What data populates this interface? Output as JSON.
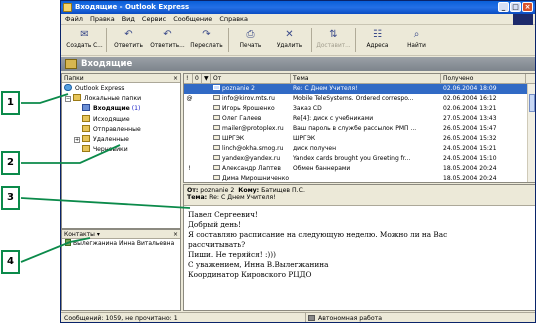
{
  "window": {
    "title": "Входящие - Outlook Express",
    "controls": [
      "_",
      "□",
      "×"
    ]
  },
  "menu": [
    "Файл",
    "Правка",
    "Вид",
    "Сервис",
    "Сообщение",
    "Справка"
  ],
  "toolbar": [
    {
      "label": "Создать С...",
      "icon": "new-mail-icon",
      "enabled": true
    },
    {
      "label": "Ответить",
      "icon": "reply-icon",
      "enabled": true
    },
    {
      "label": "Ответить...",
      "icon": "reply-all-icon",
      "enabled": true
    },
    {
      "label": "Переслать",
      "icon": "forward-icon",
      "enabled": true
    },
    {
      "label": "Печать",
      "icon": "print-icon",
      "enabled": true
    },
    {
      "label": "Удалить",
      "icon": "delete-icon",
      "enabled": true
    },
    {
      "label": "Доставит...",
      "icon": "send-receive-icon",
      "enabled": false
    },
    {
      "label": "Адреса",
      "icon": "address-book-icon",
      "enabled": true
    },
    {
      "label": "Найти",
      "icon": "find-icon",
      "enabled": true
    }
  ],
  "folder_title": "Входящие",
  "folders_pane": {
    "title": "Папки",
    "close": "×",
    "items": [
      {
        "label": "Outlook Express",
        "count": "",
        "level": 0,
        "type": "root"
      },
      {
        "label": "Локальные папки",
        "count": "",
        "level": 1,
        "type": "folder",
        "expander": "−"
      },
      {
        "label": "Входящие",
        "count": "(1)",
        "level": 2,
        "type": "inbox",
        "selected": true
      },
      {
        "label": "Исходящие",
        "count": "",
        "level": 2,
        "type": "folder"
      },
      {
        "label": "Отправленные",
        "count": "",
        "level": 2,
        "type": "folder"
      },
      {
        "label": "Удаленные",
        "count": "",
        "level": 2,
        "type": "folder",
        "expander": "+"
      },
      {
        "label": "Черновики",
        "count": "",
        "level": 2,
        "type": "folder"
      }
    ]
  },
  "contacts_pane": {
    "title": "Контакты",
    "close": "×",
    "items": [
      "Вылегжанина Инна Витальевна"
    ]
  },
  "message_list": {
    "columns": [
      "!",
      "0",
      "▼",
      "От",
      "Тема",
      "Получено"
    ],
    "messages": [
      {
        "from": "poznanie 2",
        "subject": "Re: С Днем Учителя!",
        "received": "02.06.2004 18:09",
        "attach": "",
        "selected": true
      },
      {
        "from": "info@kirov.mts.ru",
        "subject": "Mobile TeleSystems. Ordered correspo...",
        "received": "02.06.2004 16:12",
        "attach": "@",
        "selected": false
      },
      {
        "from": "Игорь Ярошенко",
        "subject": "Заказ CD",
        "received": "02.06.2004 13:21",
        "attach": "",
        "selected": false
      },
      {
        "from": "Олег Галеев",
        "subject": "Re[4]: диск с учебниками",
        "received": "27.05.2004 13:43",
        "attach": "",
        "selected": false
      },
      {
        "from": "mailer@protoplex.ru",
        "subject": "Ваш пароль в службе рассылок РМП ...",
        "received": "26.05.2004 15:47",
        "attach": "",
        "selected": false
      },
      {
        "from": "ШРГЭК",
        "subject": "ШРГЭК",
        "received": "26.05.2004 15:32",
        "attach": "",
        "selected": false
      },
      {
        "from": "linch@okha.smog.ru",
        "subject": "диск получен",
        "received": "24.05.2004 15:21",
        "attach": "",
        "selected": false
      },
      {
        "from": "yandex@yandex.ru",
        "subject": "Yandex cards brought you Greeting fr...",
        "received": "24.05.2004 15:10",
        "attach": "",
        "selected": false
      },
      {
        "from": "Александр Лаптев",
        "subject": "Обмен баннерами",
        "received": "18.05.2004 20:24",
        "attach": "!",
        "selected": false
      },
      {
        "from": "Дима Мирошниченко",
        "subject": "",
        "received": "18.05.2004 20:24",
        "attach": "",
        "selected": false
      }
    ]
  },
  "preview": {
    "from_label": "От:",
    "from": "poznanie 2",
    "to_label": "Кому:",
    "to": "Батищев П.С.",
    "subject_label": "Тема:",
    "subject": "Re: С Днем Учителя!",
    "body": [
      "Павел Сергеевич!",
      "Добрый день!",
      "Я составляю расписание на следующую неделю. Можно ли на Вас",
      "рассчитывать?",
      "Пиши. Не теряйся! :)))",
      "С уважением, Инна В.Вылегжанина",
      "Координатор Кировского РЦДО"
    ]
  },
  "status": {
    "counts": "Сообщений: 1059, не прочитано: 1",
    "mode": "Автономная работа"
  },
  "callouts": [
    "1",
    "2",
    "3",
    "4"
  ],
  "colors": {
    "callout_border": "#0b8a4a",
    "selection": "#316ac5",
    "titlebar": "#0a5fd8"
  }
}
